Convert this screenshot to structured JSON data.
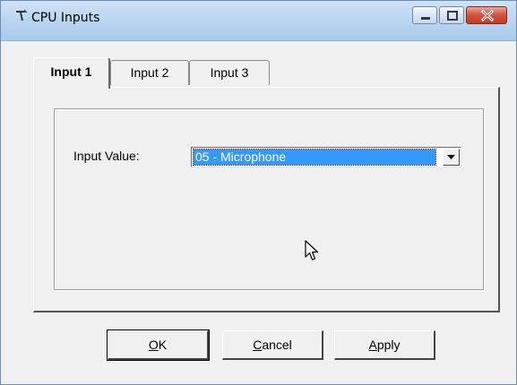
{
  "window": {
    "title": "CPU Inputs",
    "icons": {
      "app": "app-icon",
      "minimize": "minimize-icon",
      "maximize": "maximize-icon",
      "close": "close-icon"
    },
    "colors": {
      "titlebar": "#bcd6f0",
      "close_button": "#c94a32",
      "selection": "#3399ff"
    }
  },
  "tabs": [
    {
      "label": "Input 1",
      "active": true
    },
    {
      "label": "Input 2",
      "active": false
    },
    {
      "label": "Input 3",
      "active": false
    }
  ],
  "form": {
    "input_value_label": "Input Value:",
    "input_value_selected": "05 - Microphone"
  },
  "buttons": {
    "ok": {
      "accel": "O",
      "rest": "K"
    },
    "cancel": {
      "accel": "C",
      "rest": "ancel"
    },
    "apply": {
      "accel": "A",
      "rest": "pply"
    }
  }
}
